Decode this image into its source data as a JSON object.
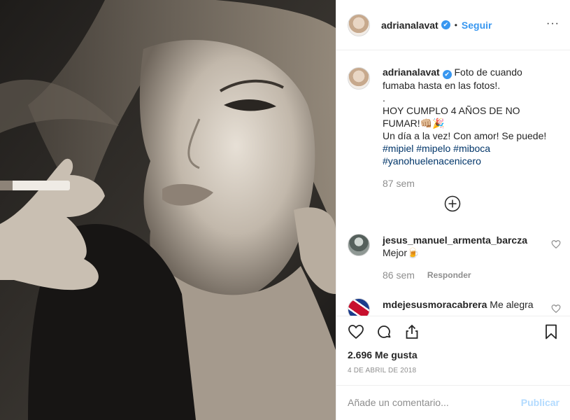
{
  "header": {
    "username": "adrianalavat",
    "verified_mark": "✔",
    "separator": "•",
    "follow_label": "Seguir",
    "more_label": "···"
  },
  "photo": {
    "description_icon": "portrait-photo"
  },
  "caption": {
    "username": "adrianalavat",
    "text_line1": " Foto de cuando fumaba hasta en las fotos!.",
    "text_line2": ".",
    "text_line3": "HOY CUMPLO 4 AÑOS DE NO FUMAR!👊🏼🎉",
    "text_line4": "Un día a la vez! Con amor! Se puede!",
    "hashtags_line1": "#mipiel #mipelo #miboca",
    "hashtags_line2": "#yanohuelenacenicero",
    "time": "87 sem"
  },
  "comments": [
    {
      "username": "jesus_manuel_armenta_barcza",
      "text": "Mejor🍺",
      "time": "86 sem",
      "reply_label": "Responder"
    },
    {
      "username": "mdejesusmoracabrera",
      "text": " Me alegra"
    }
  ],
  "actions": {
    "likes": "2.696 Me gusta",
    "date": "4 DE ABRIL DE 2018"
  },
  "add_comment": {
    "placeholder": "Añade un comentario...",
    "post_label": "Publicar"
  },
  "colors": {
    "accent": "#3897f0",
    "hashtag": "#003569",
    "muted": "#8e8e8e"
  }
}
